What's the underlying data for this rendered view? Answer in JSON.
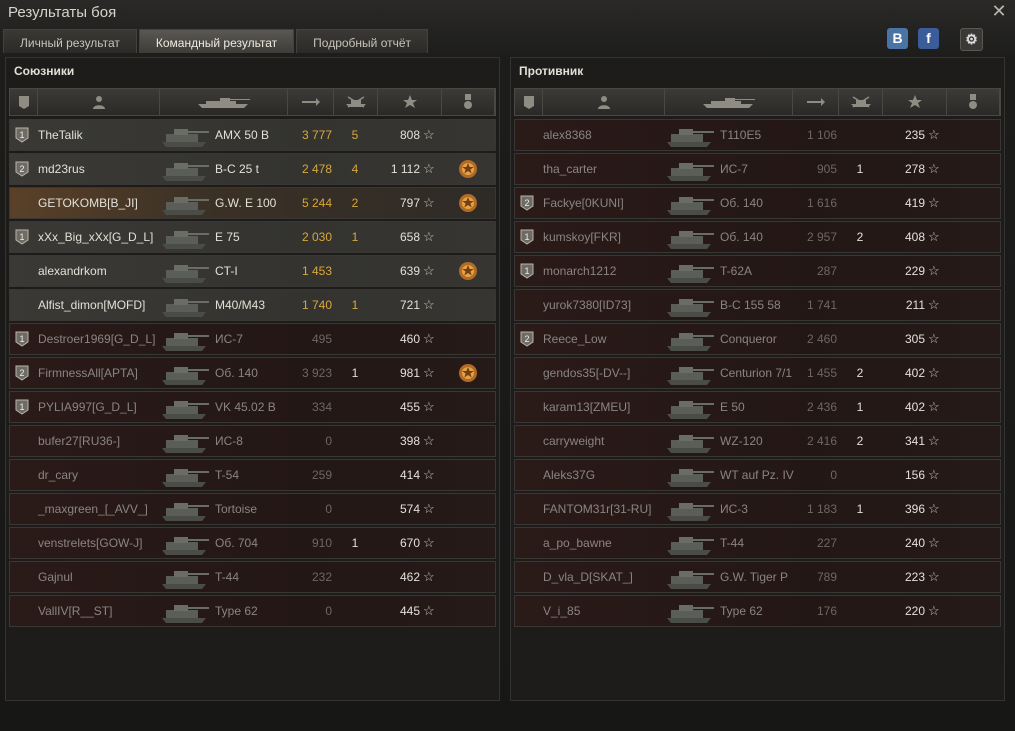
{
  "window": {
    "title": "Результаты боя"
  },
  "tabs": [
    {
      "label": "Личный результат",
      "active": false
    },
    {
      "label": "Командный результат",
      "active": true
    },
    {
      "label": "Подробный отчёт",
      "active": false
    }
  ],
  "social": {
    "vk": "B",
    "fb": "f"
  },
  "allies": {
    "title": "Союзники",
    "rows": [
      {
        "name": "TheTalik",
        "vehicle": "AMX 50 B",
        "damage": "3 777",
        "kills": "5",
        "xp": "808",
        "badge": "1",
        "medal": false,
        "state": "hl"
      },
      {
        "name": "md23rus",
        "vehicle": "B-C 25 t",
        "damage": "2 478",
        "kills": "4",
        "xp": "1 112",
        "badge": "2",
        "medal": true,
        "state": "hl"
      },
      {
        "name": "GETOKOMB[B_JI]",
        "vehicle": "G.W. E 100",
        "damage": "5 244",
        "kills": "2",
        "xp": "797",
        "badge": "",
        "medal": true,
        "state": "me"
      },
      {
        "name": "xXx_Big_xXx[G_D_L]",
        "vehicle": "E 75",
        "damage": "2 030",
        "kills": "1",
        "xp": "658",
        "badge": "1",
        "medal": false,
        "state": "hl"
      },
      {
        "name": "alexandrkom",
        "vehicle": "CT-I",
        "damage": "1 453",
        "kills": "",
        "xp": "639",
        "badge": "",
        "medal": true,
        "state": "hl"
      },
      {
        "name": "Alfist_dimon[MOFD]",
        "vehicle": "M40/M43",
        "damage": "1 740",
        "kills": "1",
        "xp": "721",
        "badge": "",
        "medal": false,
        "state": "hl"
      },
      {
        "name": "Destroer1969[G_D_L]",
        "vehicle": "ИС-7",
        "damage": "495",
        "kills": "",
        "xp": "460",
        "badge": "1",
        "medal": false,
        "state": "dead"
      },
      {
        "name": "FirmnessAll[APTA]",
        "vehicle": "Об. 140",
        "damage": "3 923",
        "kills": "1",
        "xp": "981",
        "badge": "2",
        "medal": true,
        "state": "dead"
      },
      {
        "name": "PYLIA997[G_D_L]",
        "vehicle": "VK 45.02 B",
        "damage": "334",
        "kills": "",
        "xp": "455",
        "badge": "1",
        "medal": false,
        "state": "dead"
      },
      {
        "name": "bufer27[RU36-]",
        "vehicle": "ИС-8",
        "damage": "0",
        "kills": "",
        "xp": "398",
        "badge": "",
        "medal": false,
        "state": "dead"
      },
      {
        "name": "dr_cary",
        "vehicle": "T-54",
        "damage": "259",
        "kills": "",
        "xp": "414",
        "badge": "",
        "medal": false,
        "state": "dead"
      },
      {
        "name": "_maxgreen_[_AVV_]",
        "vehicle": "Tortoise",
        "damage": "0",
        "kills": "",
        "xp": "574",
        "badge": "",
        "medal": false,
        "state": "dead"
      },
      {
        "name": "venstrelets[GOW-J]",
        "vehicle": "Об. 704",
        "damage": "910",
        "kills": "1",
        "xp": "670",
        "badge": "",
        "medal": false,
        "state": "dead"
      },
      {
        "name": "Gajnul",
        "vehicle": "T-44",
        "damage": "232",
        "kills": "",
        "xp": "462",
        "badge": "",
        "medal": false,
        "state": "dead"
      },
      {
        "name": "VallIV[R__ST]",
        "vehicle": "Type 62",
        "damage": "0",
        "kills": "",
        "xp": "445",
        "badge": "",
        "medal": false,
        "state": "dead"
      }
    ]
  },
  "enemies": {
    "title": "Противник",
    "rows": [
      {
        "name": "alex8368",
        "vehicle": "T110E5",
        "damage": "1 106",
        "kills": "",
        "xp": "235",
        "badge": "",
        "medal": false,
        "state": "dead"
      },
      {
        "name": "tha_carter",
        "vehicle": "ИС-7",
        "damage": "905",
        "kills": "1",
        "xp": "278",
        "badge": "",
        "medal": false,
        "state": "dead"
      },
      {
        "name": "Fackye[0KUNI]",
        "vehicle": "Об. 140",
        "damage": "1 616",
        "kills": "",
        "xp": "419",
        "badge": "2",
        "medal": false,
        "state": "dead"
      },
      {
        "name": "kumskoy[FKR]",
        "vehicle": "Об. 140",
        "damage": "2 957",
        "kills": "2",
        "xp": "408",
        "badge": "1",
        "medal": false,
        "state": "dead"
      },
      {
        "name": "monarch1212",
        "vehicle": "T-62A",
        "damage": "287",
        "kills": "",
        "xp": "229",
        "badge": "1",
        "medal": false,
        "state": "dead"
      },
      {
        "name": "yurok7380[ID73]",
        "vehicle": "B-C 155 58",
        "damage": "1 741",
        "kills": "",
        "xp": "211",
        "badge": "",
        "medal": false,
        "state": "dead"
      },
      {
        "name": "Reece_Low",
        "vehicle": "Conqueror",
        "damage": "2 460",
        "kills": "",
        "xp": "305",
        "badge": "2",
        "medal": false,
        "state": "dead"
      },
      {
        "name": "gendos35[-DV--]",
        "vehicle": "Centurion 7/1",
        "damage": "1 455",
        "kills": "2",
        "xp": "402",
        "badge": "",
        "medal": false,
        "state": "dead"
      },
      {
        "name": "karam13[ZMEU]",
        "vehicle": "E 50",
        "damage": "2 436",
        "kills": "1",
        "xp": "402",
        "badge": "",
        "medal": false,
        "state": "dead"
      },
      {
        "name": "carryweight",
        "vehicle": "WZ-120",
        "damage": "2 416",
        "kills": "2",
        "xp": "341",
        "badge": "",
        "medal": false,
        "state": "dead"
      },
      {
        "name": "Aleks37G",
        "vehicle": "WT auf Pz. IV",
        "damage": "0",
        "kills": "",
        "xp": "156",
        "badge": "",
        "medal": false,
        "state": "dead"
      },
      {
        "name": "FANTOM31r[31-RU]",
        "vehicle": "ИС-3",
        "damage": "1 183",
        "kills": "1",
        "xp": "396",
        "badge": "",
        "medal": false,
        "state": "dead"
      },
      {
        "name": "a_po_bawne",
        "vehicle": "T-44",
        "damage": "227",
        "kills": "",
        "xp": "240",
        "badge": "",
        "medal": false,
        "state": "dead"
      },
      {
        "name": "D_vla_D[SKAT_]",
        "vehicle": "G.W. Tiger P",
        "damage": "789",
        "kills": "",
        "xp": "223",
        "badge": "",
        "medal": false,
        "state": "dead"
      },
      {
        "name": "V_i_85",
        "vehicle": "Type 62",
        "damage": "176",
        "kills": "",
        "xp": "220",
        "badge": "",
        "medal": false,
        "state": "dead"
      }
    ]
  },
  "icons": {
    "xp_star": "☆"
  }
}
